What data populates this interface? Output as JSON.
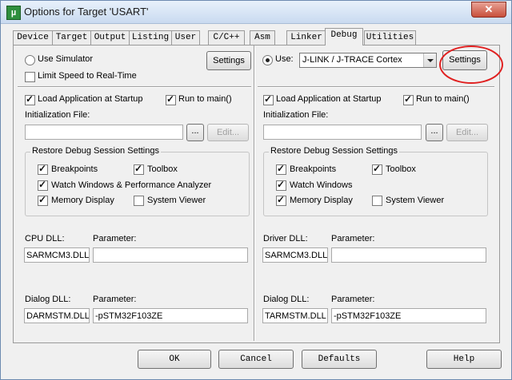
{
  "window": {
    "title": "Options for Target 'USART'",
    "close_glyph": "✕"
  },
  "tabs": [
    "Device",
    "Target",
    "Output",
    "Listing",
    "User",
    "C/C++",
    "Asm",
    "Linker",
    "Debug",
    "Utilities"
  ],
  "active_tab": "Debug",
  "left": {
    "use_simulator": "Use Simulator",
    "limit_speed": "Limit Speed to Real-Time",
    "settings": "Settings",
    "load_app": "Load Application at Startup",
    "run_to_main": "Run to main()",
    "init_file_label": "Initialization File:",
    "browse": "...",
    "edit": "Edit...",
    "restore_group": "Restore Debug Session Settings",
    "breakpoints": "Breakpoints",
    "toolbox": "Toolbox",
    "watch": "Watch Windows & Performance Analyzer",
    "memory": "Memory Display",
    "system_viewer": "System Viewer",
    "cpu_dll_label": "CPU DLL:",
    "cpu_param_label": "Parameter:",
    "cpu_dll_value": "SARMCM3.DLL",
    "cpu_param_value": "",
    "dialog_dll_label": "Dialog DLL:",
    "dialog_param_label": "Parameter:",
    "dialog_dll_value": "DARMSTM.DLL",
    "dialog_param_value": "-pSTM32F103ZE"
  },
  "right": {
    "use": "Use:",
    "driver": "J-LINK / J-TRACE Cortex",
    "settings": "Settings",
    "load_app": "Load Application at Startup",
    "run_to_main": "Run to main()",
    "init_file_label": "Initialization File:",
    "browse": "...",
    "edit": "Edit...",
    "restore_group": "Restore Debug Session Settings",
    "breakpoints": "Breakpoints",
    "toolbox": "Toolbox",
    "watch": "Watch Windows",
    "memory": "Memory Display",
    "system_viewer": "System Viewer",
    "driver_dll_label": "Driver DLL:",
    "driver_param_label": "Parameter:",
    "driver_dll_value": "SARMCM3.DLL",
    "driver_param_value": "",
    "dialog_dll_label": "Dialog DLL:",
    "dialog_param_label": "Parameter:",
    "dialog_dll_value": "TARMSTM.DLL",
    "dialog_param_value": "-pSTM32F103ZE"
  },
  "footer": {
    "ok": "OK",
    "cancel": "Cancel",
    "defaults": "Defaults",
    "help": "Help"
  },
  "colors": {
    "annotation": "#e02020"
  }
}
